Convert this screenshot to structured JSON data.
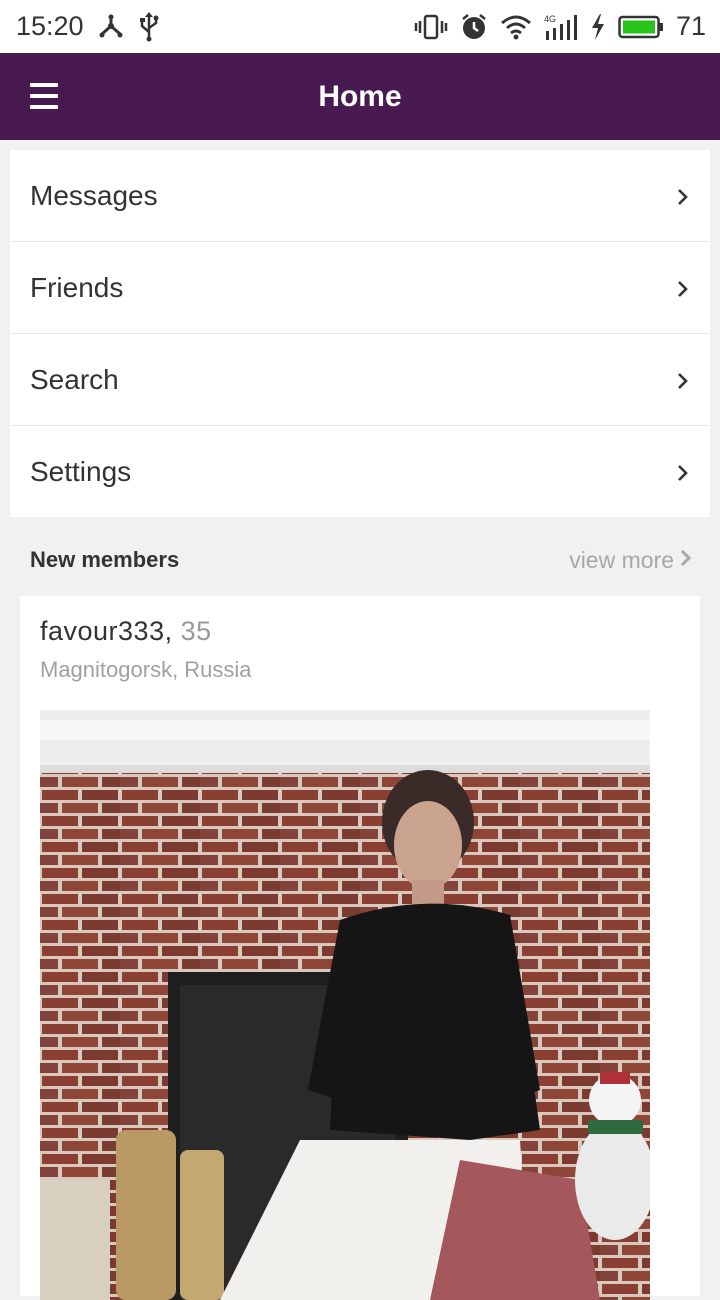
{
  "status_bar": {
    "time": "15:20",
    "battery_level": "71",
    "icons": [
      "usb-debug-icon",
      "usb-icon",
      "vibrate-icon",
      "alarm-icon",
      "wifi-icon",
      "signal-4g-icon",
      "charging-icon",
      "battery-icon"
    ]
  },
  "app_bar": {
    "title": "Home",
    "background_color": "#491a52"
  },
  "menu": {
    "items": [
      {
        "label": "Messages"
      },
      {
        "label": "Friends"
      },
      {
        "label": "Search"
      },
      {
        "label": "Settings"
      }
    ]
  },
  "new_members": {
    "heading": "New members",
    "view_more": "view more",
    "member": {
      "username": "favour333,",
      "age": "35",
      "location": "Magnitogorsk, Russia"
    }
  }
}
